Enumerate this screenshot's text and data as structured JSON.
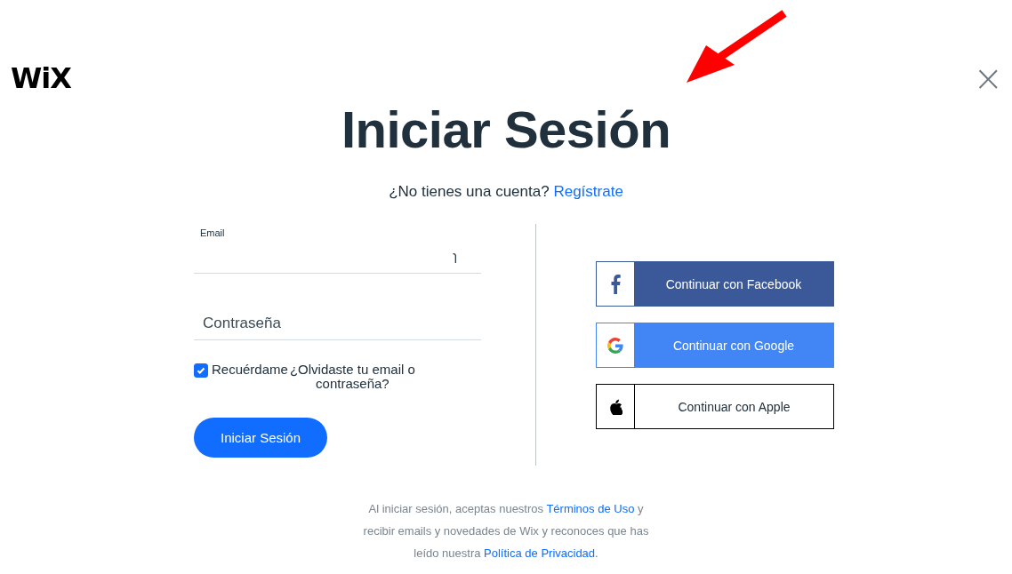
{
  "header": {
    "logo": "WiX",
    "close": "×"
  },
  "title": "Iniciar Sesión",
  "signup": {
    "prompt": "¿No tienes una cuenta?",
    "link": "Regístrate"
  },
  "form": {
    "email": {
      "label": "Email",
      "value": "ɿ"
    },
    "password": {
      "placeholder": "Contraseña"
    },
    "remember": {
      "label": "Recuérdame",
      "checked": true
    },
    "forgot": "¿Olvidaste tu email o contraseña?",
    "submit": "Iniciar Sesión"
  },
  "social": [
    {
      "kind": "facebook",
      "label": "Continuar con Facebook"
    },
    {
      "kind": "google",
      "label": "Continuar con Google"
    },
    {
      "kind": "apple",
      "label": "Continuar con Apple"
    }
  ],
  "footer": {
    "parts": [
      {
        "kind": "text",
        "text": "Al iniciar sesión, aceptas nuestros "
      },
      {
        "kind": "link",
        "text": "Términos de Uso"
      },
      {
        "kind": "text",
        "text": " y recibir emails y novedades de Wix y reconoces que has leído nuestra "
      },
      {
        "kind": "link",
        "text": "Política de Privacidad"
      },
      {
        "kind": "text",
        "text": "."
      }
    ]
  },
  "annotation": {
    "kind": "arrow"
  }
}
